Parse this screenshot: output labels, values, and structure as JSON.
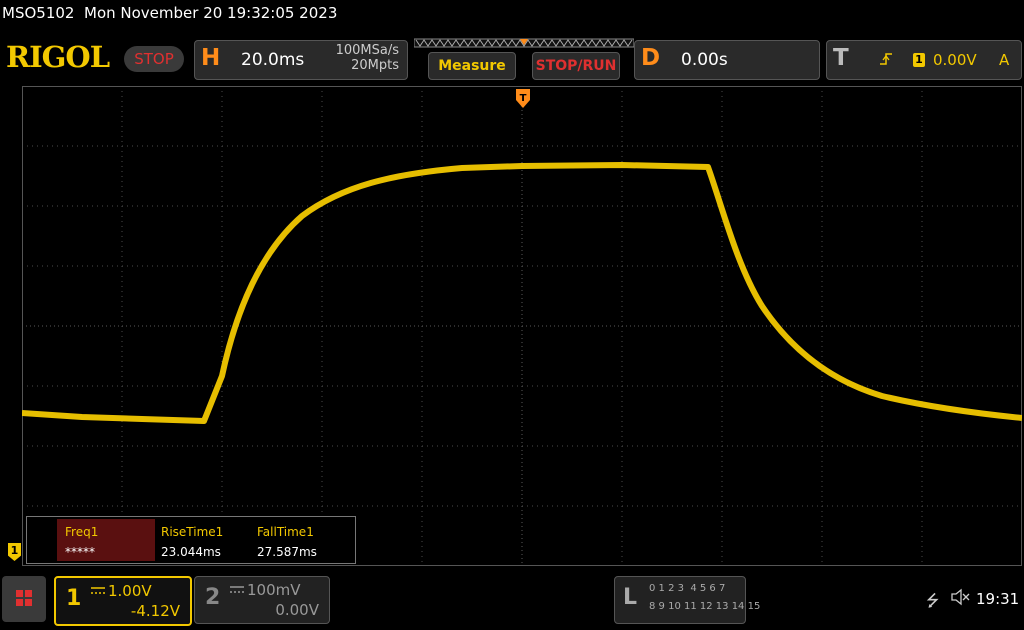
{
  "header": {
    "model": "MSO5102",
    "datetime": "Mon November 20 19:32:05 2023"
  },
  "topbar": {
    "brand": "RIGOL",
    "run_state": "STOP",
    "horizontal": {
      "letter": "H",
      "scale": "20.0ms",
      "sample_rate": "100MSa/s",
      "memory_depth": "20Mpts"
    },
    "measure_label": "Measure",
    "stoprun_label": "STOP/RUN",
    "delay": {
      "letter": "D",
      "value": "0.00s"
    },
    "trigger": {
      "letter": "T",
      "source": "1",
      "level": "0.00V",
      "mode": "A"
    }
  },
  "measurements": {
    "items": [
      {
        "name": "Freq1",
        "value": "*****"
      },
      {
        "name": "RiseTime1",
        "value": "23.044ms"
      },
      {
        "name": "FallTime1",
        "value": "27.587ms"
      }
    ]
  },
  "channels": {
    "ch1": {
      "number": "1",
      "scale": "1.00V",
      "offset": "-4.12V",
      "active": true
    },
    "ch2": {
      "number": "2",
      "scale": "100mV",
      "offset": "0.00V",
      "active": false
    }
  },
  "ground_marker": "1",
  "logic": {
    "letter": "L",
    "row1": "0 1 2 3  4 5 6 7",
    "row2": "8 9 10 11 12 13 14 15"
  },
  "status": {
    "time": "19:31"
  },
  "colors": {
    "ch1": "#f2c800",
    "accent_orange": "#ff8c1a",
    "stop_red": "#e03030",
    "grid": "#555555"
  },
  "icons": [
    "menu-icon",
    "usb-icon",
    "speaker-mute-icon",
    "trigger-slope-rising-icon",
    "trigger-position-icon"
  ]
}
